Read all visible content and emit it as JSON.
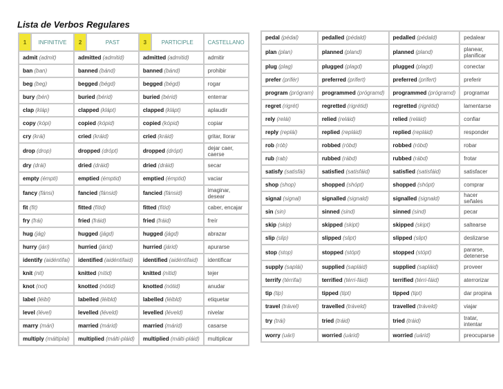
{
  "title": "Lista de Verbos Regulares",
  "header": {
    "n1": "1",
    "infinitive": "INFINITIVE",
    "n2": "2",
    "past": "PAST",
    "n3": "3",
    "participle": "PARTICIPLE",
    "castellano": "CASTELLANO"
  },
  "left_rows": [
    {
      "inf": "admit",
      "inf_p": "(admit)",
      "past": "admitted",
      "past_p": "(admitid)",
      "part": "admitted",
      "part_p": "(admitid)",
      "es": "admitir"
    },
    {
      "inf": "ban",
      "inf_p": "(ban)",
      "past": "banned",
      "past_p": "(bánd)",
      "part": "banned",
      "part_p": "(bánd)",
      "es": "prohibir"
    },
    {
      "inf": "beg",
      "inf_p": "(beg)",
      "past": "begged",
      "past_p": "(bégd)",
      "part": "begged",
      "part_p": "(bégd)",
      "es": "rogar"
    },
    {
      "inf": "bury",
      "inf_p": "(béri)",
      "past": "buried",
      "past_p": "(bérid)",
      "part": "buried",
      "part_p": "(bérid)",
      "es": "enterrar"
    },
    {
      "inf": "clap",
      "inf_p": "(kláp)",
      "past": "clapped",
      "past_p": "(klápt)",
      "part": "clapped",
      "part_p": "(klápt)",
      "es": "aplaudir"
    },
    {
      "inf": "copy",
      "inf_p": "(kópi)",
      "past": "copied",
      "past_p": "(kópid)",
      "part": "copied",
      "part_p": "(kópid)",
      "es": "copiar"
    },
    {
      "inf": "cry",
      "inf_p": "(krái)",
      "past": "cried",
      "past_p": "(kráid)",
      "part": "cried",
      "part_p": "(kráid)",
      "es": "gritar, llorar"
    },
    {
      "inf": "drop",
      "inf_p": "(drop)",
      "past": "dropped",
      "past_p": "(drópt)",
      "part": "dropped",
      "part_p": "(drópt)",
      "es": "dejar caer, caerse",
      "tall": true
    },
    {
      "inf": "dry",
      "inf_p": "(drái)",
      "past": "dried",
      "past_p": "(dráid)",
      "part": "dried",
      "part_p": "(dráid)",
      "es": "secar"
    },
    {
      "inf": "empty",
      "inf_p": "(émpti)",
      "past": "emptied",
      "past_p": "(émptid)",
      "part": "emptied",
      "part_p": "(émptid)",
      "es": "vaciar"
    },
    {
      "inf": "fancy",
      "inf_p": "(fánsi)",
      "past": "fancied",
      "past_p": "(fánsid)",
      "part": "fancied",
      "part_p": "(fánsid)",
      "es": "imaginar, desear",
      "tall": true
    },
    {
      "inf": "fit",
      "inf_p": "(fit)",
      "past": "fitted",
      "past_p": "(fítid)",
      "part": "fitted",
      "part_p": "(fítid)",
      "es": "caber, encajar"
    },
    {
      "inf": "fry",
      "inf_p": "(frái)",
      "past": "fried",
      "past_p": "(fráid)",
      "part": "fried",
      "part_p": "(fráid)",
      "es": "freír"
    },
    {
      "inf": "hug",
      "inf_p": "(jág)",
      "past": "hugged",
      "past_p": "(jágd)",
      "part": "hugged",
      "part_p": "(jágd)",
      "es": "abrazar"
    },
    {
      "inf": "hurry",
      "inf_p": "(jári)",
      "past": "hurried",
      "past_p": "(járid)",
      "part": "hurried",
      "part_p": "(járid)",
      "es": "apurarse"
    },
    {
      "inf": "identify",
      "inf_p": "(aidéntifai)",
      "past": "identified",
      "past_p": "(aidéntifaid)",
      "part": "identified",
      "part_p": "(aidéntifaid)",
      "es": "identificar"
    },
    {
      "inf": "knit",
      "inf_p": "(nit)",
      "past": "knitted",
      "past_p": "(nítid)",
      "part": "knitted",
      "part_p": "(nítid)",
      "es": "tejer"
    },
    {
      "inf": "knot",
      "inf_p": "(not)",
      "past": "knotted",
      "past_p": "(nótid)",
      "part": "knotted",
      "part_p": "(nótid)",
      "es": "anudar"
    },
    {
      "inf": "label",
      "inf_p": "(léibl)",
      "past": "labelled",
      "past_p": "(léibld)",
      "part": "labelled",
      "part_p": "(léibld)",
      "es": "etiquetar"
    },
    {
      "inf": "level",
      "inf_p": "(lével)",
      "past": "levelled",
      "past_p": "(léveld)",
      "part": "levelled",
      "part_p": "(léveld)",
      "es": "nivelar"
    },
    {
      "inf": "marry",
      "inf_p": "(mári)",
      "past": "married",
      "past_p": "(márid)",
      "part": "married",
      "part_p": "(márid)",
      "es": "casarse"
    },
    {
      "inf": "multiply",
      "inf_p": "(máltiplai)",
      "past": "multiplied",
      "past_p": "(málti-pláid)",
      "part": "multiplied",
      "part_p": "(málti-pláid)",
      "es": "multiplicar"
    }
  ],
  "right_rows": [
    {
      "inf": "pedal",
      "inf_p": "(pédal)",
      "past": "pedalled",
      "past_p": "(pédald)",
      "part": "pedalled",
      "part_p": "(pédald)",
      "es": "pedalear"
    },
    {
      "inf": "plan",
      "inf_p": "(plan)",
      "past": "planned",
      "past_p": "(pland)",
      "part": "planned",
      "part_p": "(pland)",
      "es": "planear, planificar",
      "tall": true
    },
    {
      "inf": "plug",
      "inf_p": "(plag)",
      "past": "plugged",
      "past_p": "(plagd)",
      "part": "plugged",
      "part_p": "(plagd)",
      "es": "conectar"
    },
    {
      "inf": "prefer",
      "inf_p": "(prifér)",
      "past": "preferred",
      "past_p": "(prifert)",
      "part": "preferred",
      "part_p": "(prifert)",
      "es": "preferir"
    },
    {
      "inf": "program",
      "inf_p": "(prógram)",
      "past": "programmed",
      "past_p": "(prógramd)",
      "part": "programmed",
      "part_p": "(prógramd)",
      "es": "programar"
    },
    {
      "inf": "regret",
      "inf_p": "(rigrét)",
      "past": "regretted",
      "past_p": "(rigrétid)",
      "part": "regretted",
      "part_p": "(rigrétid)",
      "es": "lamentarse"
    },
    {
      "inf": "rely",
      "inf_p": "(relái)",
      "past": "relied",
      "past_p": "(reláid)",
      "part": "relied",
      "part_p": "(reláid)",
      "es": "confiar"
    },
    {
      "inf": "reply",
      "inf_p": "(replái)",
      "past": "replied",
      "past_p": "(repláid)",
      "part": "replied",
      "part_p": "(repláid)",
      "es": "responder"
    },
    {
      "inf": "rob",
      "inf_p": "(rób)",
      "past": "robbed",
      "past_p": "(róbd)",
      "part": "robbed",
      "part_p": "(róbd)",
      "es": "robar"
    },
    {
      "inf": "rub",
      "inf_p": "(rab)",
      "past": "rubbed",
      "past_p": "(rábd)",
      "part": "rubbed",
      "part_p": "(rábd)",
      "es": "frotar"
    },
    {
      "inf": "satisfy",
      "inf_p": "(satisfái)",
      "past": "satisfied",
      "past_p": "(satisfáid)",
      "part": "satisfied",
      "part_p": "(satisfáid)",
      "es": "satisfacer"
    },
    {
      "inf": "shop",
      "inf_p": "(shop)",
      "past": "shopped",
      "past_p": "(shópt)",
      "part": "shopped",
      "part_p": "(shópt)",
      "es": "comprar"
    },
    {
      "inf": "signal",
      "inf_p": "(signal)",
      "past": "signalled",
      "past_p": "(signald)",
      "part": "signalled",
      "part_p": "(signald)",
      "es": "hacer señales"
    },
    {
      "inf": "sin",
      "inf_p": "(sin)",
      "past": "sinned",
      "past_p": "(sind)",
      "part": "sinned",
      "part_p": "(sind)",
      "es": "pecar"
    },
    {
      "inf": "skip",
      "inf_p": "(skip)",
      "past": "skipped",
      "past_p": "(skipt)",
      "part": "skipped",
      "part_p": "(skipt)",
      "es": "saltearse"
    },
    {
      "inf": "slip",
      "inf_p": "(slip)",
      "past": "slipped",
      "past_p": "(slipt)",
      "part": "slipped",
      "part_p": "(slipt)",
      "es": "deslizarse"
    },
    {
      "inf": "stop",
      "inf_p": "(stop)",
      "past": "stopped",
      "past_p": "(stópt)",
      "part": "stopped",
      "part_p": "(stópt)",
      "es": "pararse, detenerse",
      "tall": true
    },
    {
      "inf": "supply",
      "inf_p": "(saplái)",
      "past": "supplied",
      "past_p": "(sapláid)",
      "part": "supplied",
      "part_p": "(sapláid)",
      "es": "proveer"
    },
    {
      "inf": "terrify",
      "inf_p": "(térrifai)",
      "past": "terrified",
      "past_p": "(térri-fáid)",
      "part": "terrified",
      "part_p": "(térri-fáid)",
      "es": "aterrorizar"
    },
    {
      "inf": "tip",
      "inf_p": "(tip)",
      "past": "tipped",
      "past_p": "(tipt)",
      "part": "tipped",
      "part_p": "(tipt)",
      "es": "dar propina"
    },
    {
      "inf": "travel",
      "inf_p": "(trável)",
      "past": "travelled",
      "past_p": "(tráveld)",
      "part": "travelled",
      "part_p": "(tráveld)",
      "es": "viajar"
    },
    {
      "inf": "try",
      "inf_p": "(trái)",
      "past": "tried",
      "past_p": "(tráid)",
      "part": "tried",
      "part_p": "(tráid)",
      "es": "tratar, intentar",
      "tall": true
    },
    {
      "inf": "worry",
      "inf_p": "(uári)",
      "past": "worried",
      "past_p": "(uárid)",
      "part": "worried",
      "part_p": "(uárid)",
      "es": "preocuparse"
    }
  ]
}
